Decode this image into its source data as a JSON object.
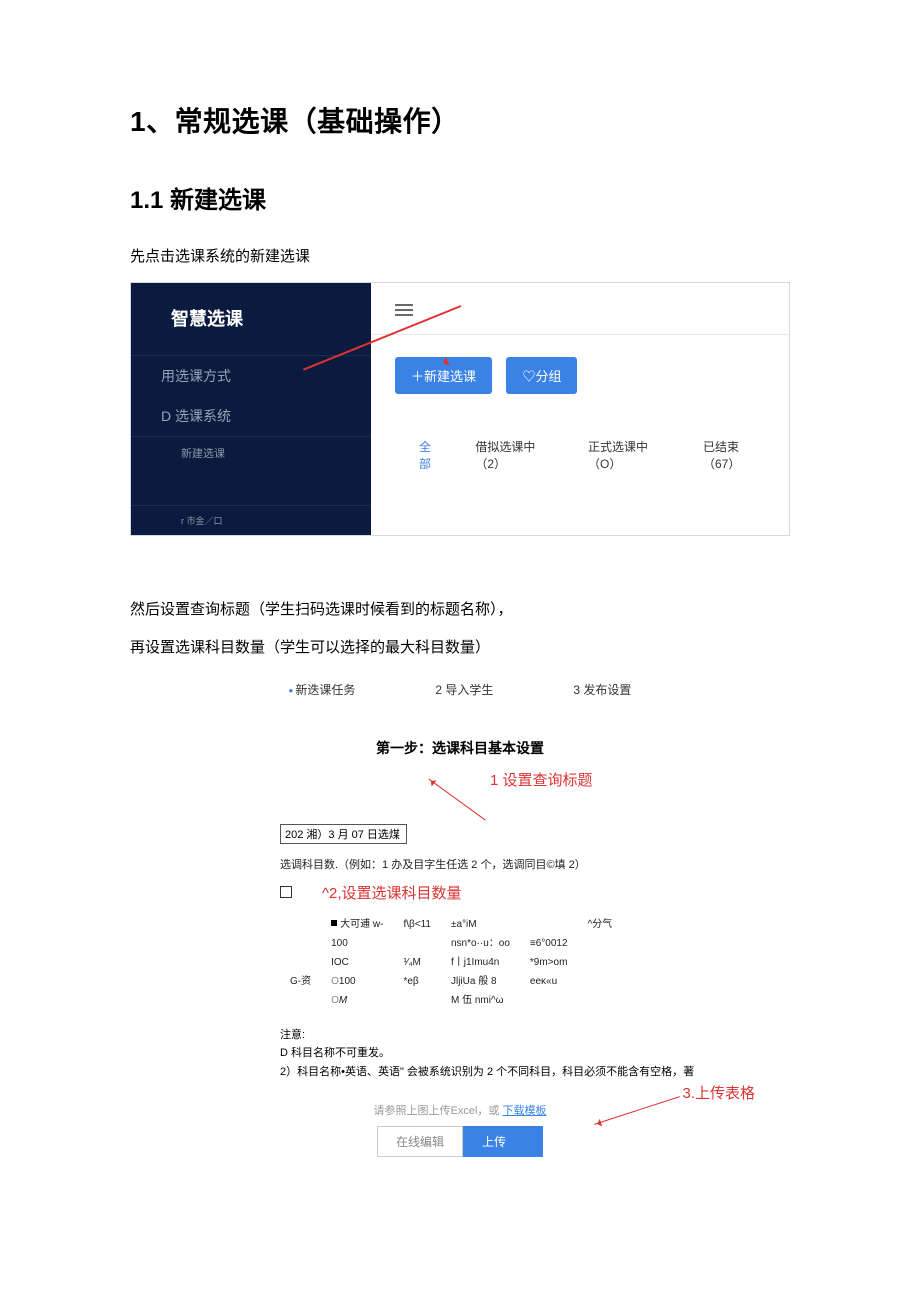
{
  "doc": {
    "h1": "1、常规选课（基础操作）",
    "h2": "1.1 新建选课",
    "p1": "先点击选课系统的新建选课",
    "p2": "然后设置查询标题（学生扫码选课时候看到的标题名称），",
    "p3": "再设置选课科目数量（学生可以选择的最大科目数量）"
  },
  "shot1": {
    "brand": "智慧选课",
    "menu1": "用选课方式",
    "menu2": "D 选课系统",
    "menu2a": "新建选课",
    "menu_foot": "r 市金／口",
    "btn_new": "＋新建选课",
    "btn_group": "♡分组",
    "tabs": {
      "all": "全部",
      "draft": "借拟选课中（2）",
      "active": "正式选课中（O）",
      "done": "已结束（67）"
    }
  },
  "shot2": {
    "steps": {
      "s1": "新迭课任务",
      "s2": "2 导入学生",
      "s3": "3 发布设置"
    },
    "step_title": "第一步：选课科目基本设置",
    "anno1": "1 设置查询标题",
    "title_input": "202 湘）3 月 07 日选煤",
    "desc": "选调科目数.（例如：1 办及目字生任选 2 个，选调同目©填 2）",
    "anno2": "^2,设置选课科目数量",
    "grid": {
      "r1c1": "大可逋 w-",
      "r1c2": "f\\β<11",
      "r1c3": "±a°iM",
      "r1c4": "^分气",
      "r2c1": "100",
      "r2c2": "",
      "r2c3": "nsn*o··u：oo",
      "r2c3b": "≡6°0012",
      "r3c1": "IOC",
      "r3c2": "¹⁄₄M",
      "r3c3": "f丨j1Imu4n",
      "r3c3b": "*9m>om",
      "r4lead": "G-资",
      "r4c1": "100",
      "r4c2": "*eβ",
      "r4c3": "JljiUa 般 8",
      "r4c3b": "eeκ«u",
      "r5c1": "M",
      "r5c3": "M 伍 nmi^ω"
    },
    "note_head": "注意:",
    "note1": "D 科目名称不可重发。",
    "note2": "2）科目名称•英语、英语\" 会被系统识别为 2 个不同科目，科目必须不能含有空格，著",
    "upload_hint_pre": "请参照上图上传Excel，或",
    "upload_hint_link": "下载模板",
    "btn_edit": "在线编辑",
    "btn_upload": "上传",
    "anno3": "3.上传表格"
  }
}
